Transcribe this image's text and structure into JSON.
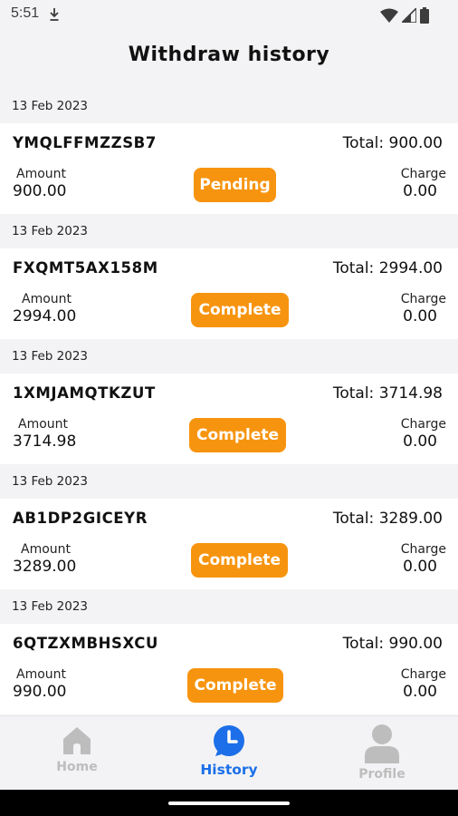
{
  "status_bar": {
    "time": "5:51"
  },
  "header": {
    "title": "Withdraw history"
  },
  "labels": {
    "amount": "Amount",
    "charge": "Charge"
  },
  "colors": {
    "accent": "#f7940f",
    "active_nav": "#1c6fe8",
    "inactive_nav": "#bdbdbd"
  },
  "records": [
    {
      "date": "13 Feb 2023",
      "id": "YMQLFFMZZSB7",
      "total": "Total: 900.00",
      "amount": "900.00",
      "status": "Pending",
      "charge": "0.00"
    },
    {
      "date": "13 Feb 2023",
      "id": "FXQMT5AX158M",
      "total": "Total: 2994.00",
      "amount": "2994.00",
      "status": "Complete",
      "charge": "0.00"
    },
    {
      "date": "13 Feb 2023",
      "id": "1XMJAMQTKZUT",
      "total": "Total: 3714.98",
      "amount": "3714.98",
      "status": "Complete",
      "charge": "0.00"
    },
    {
      "date": "13 Feb 2023",
      "id": "AB1DP2GICEYR",
      "total": "Total: 3289.00",
      "amount": "3289.00",
      "status": "Complete",
      "charge": "0.00"
    },
    {
      "date": "13 Feb 2023",
      "id": "6QTZXMBHSXCU",
      "total": "Total: 990.00",
      "amount": "990.00",
      "status": "Complete",
      "charge": "0.00"
    }
  ],
  "nav": [
    {
      "label": "Home",
      "icon": "home-icon",
      "active": false
    },
    {
      "label": "History",
      "icon": "clock-icon",
      "active": true
    },
    {
      "label": "Profile",
      "icon": "person-icon",
      "active": false
    }
  ]
}
